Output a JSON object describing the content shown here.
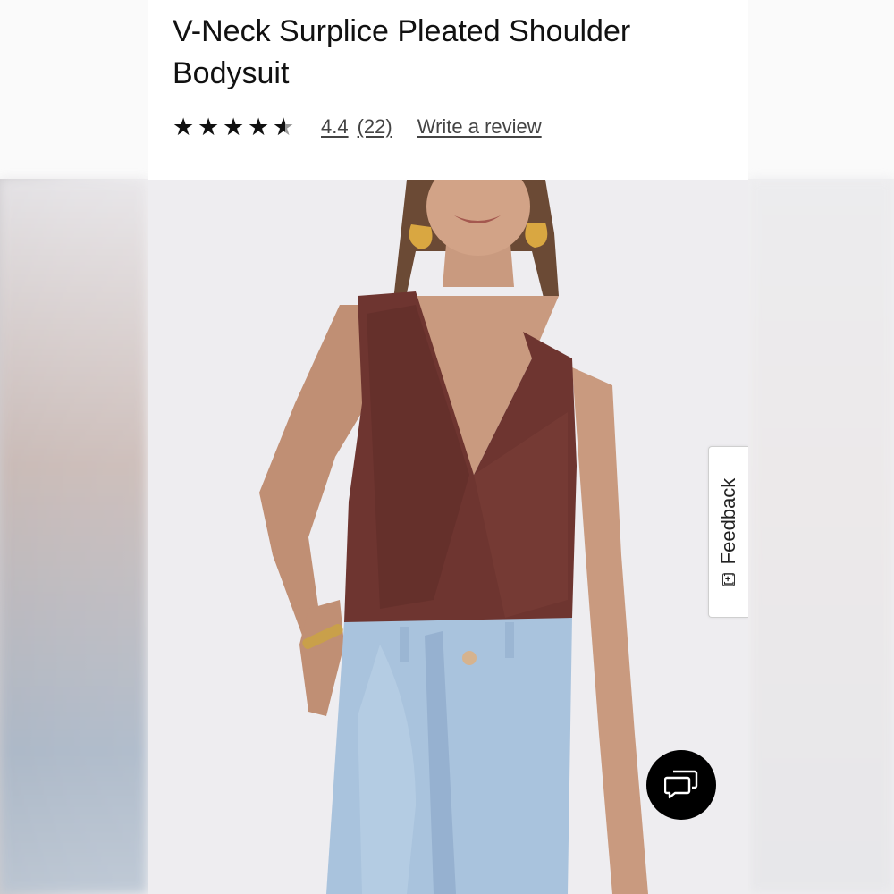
{
  "product": {
    "title": "V-Neck Surplice Pleated Shoulder Bodysuit",
    "rating_value": "4.4",
    "rating_count": "(22)",
    "rating": 4.4,
    "max_rating": 5,
    "write_review_label": "Write a review",
    "image_alt": "Model wearing a burgundy sleeveless v-neck surplice bodysuit with light wash jeans"
  },
  "feedback_tab": {
    "label": "Feedback",
    "icon": "[+]"
  },
  "chat": {
    "icon": "chat-bubbles-icon"
  },
  "colors": {
    "bodysuit": "#6e3530",
    "denim": "#a9c3dd",
    "background": "#f0eff2",
    "text": "#111111"
  }
}
